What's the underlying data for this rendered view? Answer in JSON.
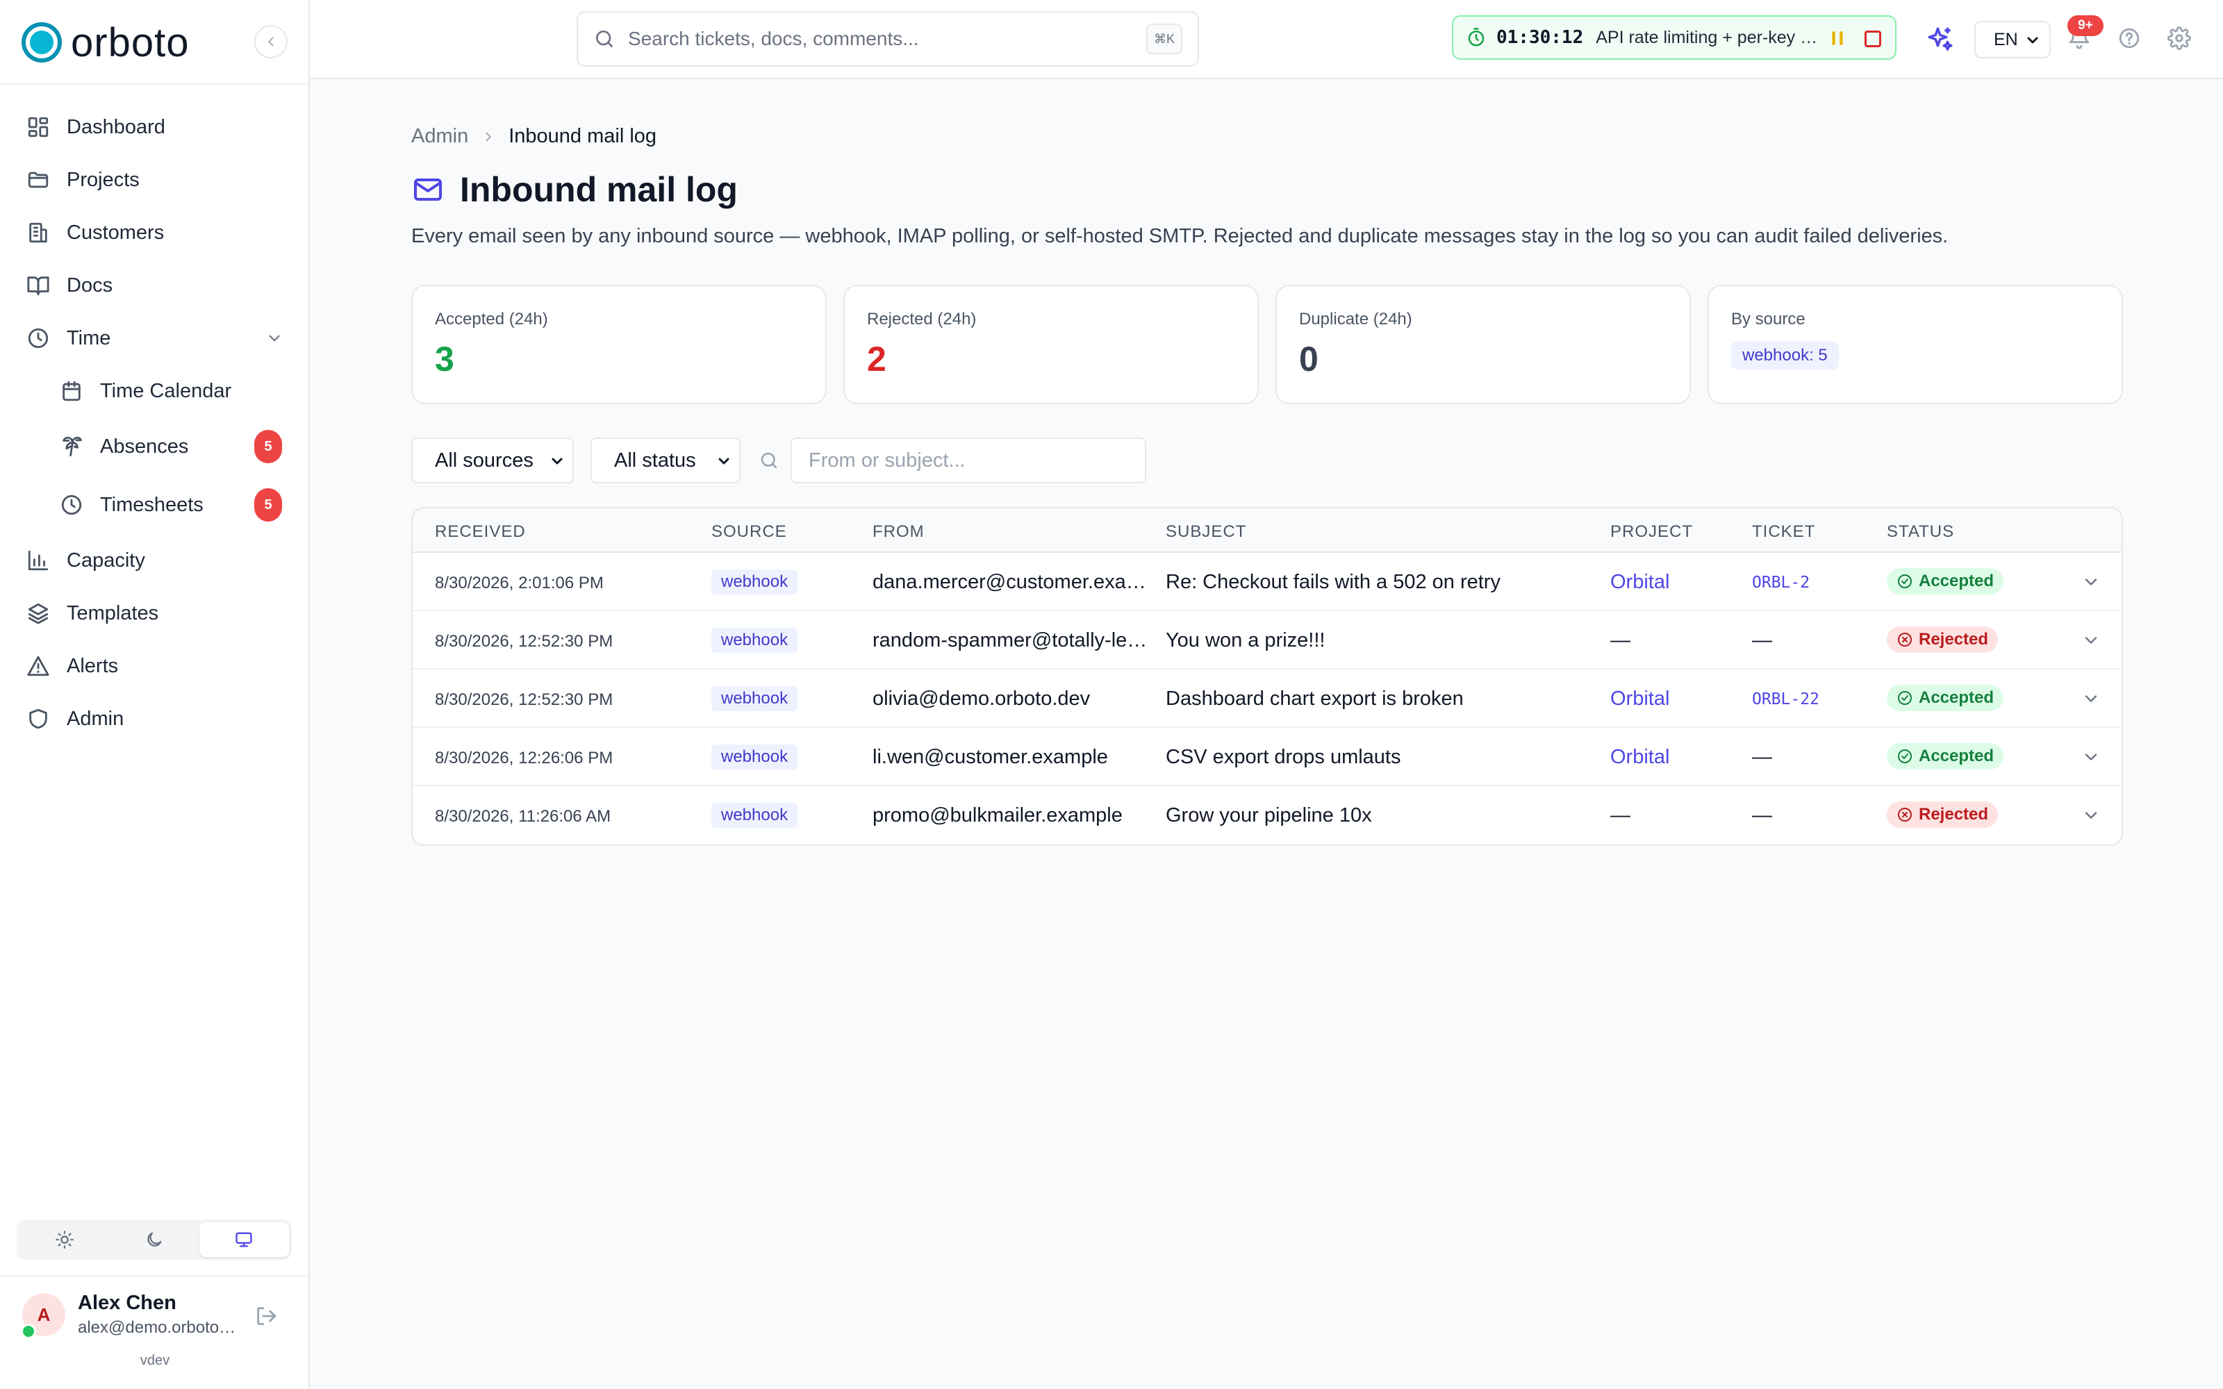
{
  "brand": {
    "name": "orboto",
    "accent": "#0891b2"
  },
  "sidebar": {
    "items": [
      {
        "label": "Dashboard",
        "icon": "dashboard-icon"
      },
      {
        "label": "Projects",
        "icon": "folder-icon"
      },
      {
        "label": "Customers",
        "icon": "building-icon"
      },
      {
        "label": "Docs",
        "icon": "book-icon"
      },
      {
        "label": "Time",
        "icon": "clock-icon",
        "expanded": true
      },
      {
        "label": "Time Calendar",
        "icon": "calendar-icon",
        "sub": true
      },
      {
        "label": "Absences",
        "icon": "palm-tree-icon",
        "sub": true,
        "badge": "5"
      },
      {
        "label": "Timesheets",
        "icon": "clock-icon",
        "sub": true,
        "badge": "5"
      },
      {
        "label": "Capacity",
        "icon": "bar-chart-icon"
      },
      {
        "label": "Templates",
        "icon": "layers-icon"
      },
      {
        "label": "Alerts",
        "icon": "alert-triangle-icon"
      },
      {
        "label": "Admin",
        "icon": "shield-icon"
      }
    ],
    "theme_options": [
      "light",
      "dark",
      "system"
    ],
    "theme_selected": "system",
    "user": {
      "initial": "A",
      "name": "Alex Chen",
      "email": "alex@demo.orboto.dev",
      "status": "online"
    },
    "version": "vdev"
  },
  "topbar": {
    "search_placeholder": "Search tickets, docs, comments...",
    "search_shortcut": "⌘K",
    "timer": {
      "time": "01:30:12",
      "task": "API rate limiting + per-key quotas"
    },
    "language": "EN",
    "notifications_badge": "9+"
  },
  "breadcrumb": {
    "parent": "Admin",
    "current": "Inbound mail log"
  },
  "page": {
    "title": "Inbound mail log",
    "description": "Every email seen by any inbound source — webhook, IMAP polling, or self-hosted SMTP. Rejected and duplicate messages stay in the log so you can audit failed deliveries."
  },
  "stats": [
    {
      "label": "Accepted (24h)",
      "value": "3",
      "color": "#16a34a"
    },
    {
      "label": "Rejected (24h)",
      "value": "2",
      "color": "#dc2626"
    },
    {
      "label": "Duplicate (24h)",
      "value": "0",
      "color": "#374151"
    },
    {
      "label": "By source",
      "pill": "webhook: 5"
    }
  ],
  "filters": {
    "source_selected": "All sources",
    "status_selected": "All status",
    "search_placeholder": "From or subject..."
  },
  "table": {
    "columns": [
      "Received",
      "Source",
      "From",
      "Subject",
      "Project",
      "Ticket",
      "Status"
    ],
    "rows": [
      {
        "received": "8/30/2026, 2:01:06 PM",
        "source": "webhook",
        "from": "dana.mercer@customer.example",
        "subject": "Re: Checkout fails with a 502 on retry",
        "project": "Orbital",
        "ticket": "ORBL-2",
        "status": "Accepted"
      },
      {
        "received": "8/30/2026, 12:52:30 PM",
        "source": "webhook",
        "from": "random-spammer@totally-legit.example",
        "subject": "You won a prize!!!",
        "project": "—",
        "ticket": "—",
        "status": "Rejected"
      },
      {
        "received": "8/30/2026, 12:52:30 PM",
        "source": "webhook",
        "from": "olivia@demo.orboto.dev",
        "subject": "Dashboard chart export is broken",
        "project": "Orbital",
        "ticket": "ORBL-22",
        "status": "Accepted"
      },
      {
        "received": "8/30/2026, 12:26:06 PM",
        "source": "webhook",
        "from": "li.wen@customer.example",
        "subject": "CSV export drops umlauts",
        "project": "Orbital",
        "ticket": "—",
        "status": "Accepted"
      },
      {
        "received": "8/30/2026, 11:26:06 AM",
        "source": "webhook",
        "from": "promo@bulkmailer.example",
        "subject": "Grow your pipeline 10x",
        "project": "—",
        "ticket": "—",
        "status": "Rejected"
      }
    ]
  }
}
